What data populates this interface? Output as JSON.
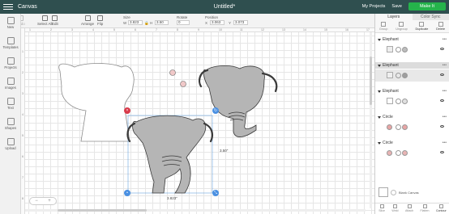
{
  "topbar": {
    "app_label": "Canvas",
    "doc_title": "Untitled*",
    "my_projects": "My Projects",
    "save": "Save",
    "make_it": "Make It"
  },
  "toolbar": {
    "undo": "Undo",
    "redo": "Redo",
    "select_all": "Select All",
    "edit": "Edit",
    "arrange": "Arrange",
    "flip": "Flip",
    "size_label": "Size",
    "w_label": "W",
    "w_value": "3.823",
    "h_label": "H",
    "h_value": "3.50",
    "rotate_label": "Rotate",
    "rotate_value": "0",
    "position_label": "Position",
    "x_label": "X",
    "x_value": "3.063",
    "y_label": "Y",
    "y_value": "3.073"
  },
  "leftbar": {
    "items": [
      "New",
      "Templates",
      "Projects",
      "Images",
      "Text",
      "Shapes",
      "Upload"
    ]
  },
  "canvas": {
    "ruler_top": [
      "1",
      "2",
      "3",
      "4",
      "5",
      "6",
      "7",
      "8",
      "9",
      "10",
      "11",
      "12",
      "13",
      "14",
      "15",
      "16",
      "17"
    ],
    "ruler_left": [
      "1",
      "2",
      "3",
      "4",
      "5",
      "6",
      "7",
      "8"
    ],
    "width_dim": "3.823\"",
    "height_dim": "3.50\""
  },
  "panel": {
    "tabs": [
      "Layers",
      "Color Sync"
    ],
    "tools": [
      "Group",
      "Ungroup",
      "Duplicate",
      "Delete"
    ],
    "layers": [
      {
        "name": "Elephant",
        "fill": "#bdbdbd",
        "selected": false
      },
      {
        "name": "Elephant",
        "fill": "#9e9e9e",
        "selected": true
      },
      {
        "name": "Elephant",
        "fill": "#e0e0e0",
        "selected": false
      },
      {
        "name": "Circle",
        "fill": "#e8a5a5",
        "selected": false
      },
      {
        "name": "Circle",
        "fill": "#e8b4b4",
        "selected": false
      }
    ],
    "blank_canvas": "Blank Canvas",
    "bottom_tools": [
      "Slice",
      "Weld",
      "Attach",
      "Flatten",
      "Contour"
    ]
  },
  "zoom": {
    "minus": "−",
    "plus": "+"
  },
  "colors": {
    "topbar": "#2f4f4f",
    "accent": "#25b34b",
    "elephant": "#b5b5b5",
    "elephant_dark": "#3a3a3a"
  }
}
